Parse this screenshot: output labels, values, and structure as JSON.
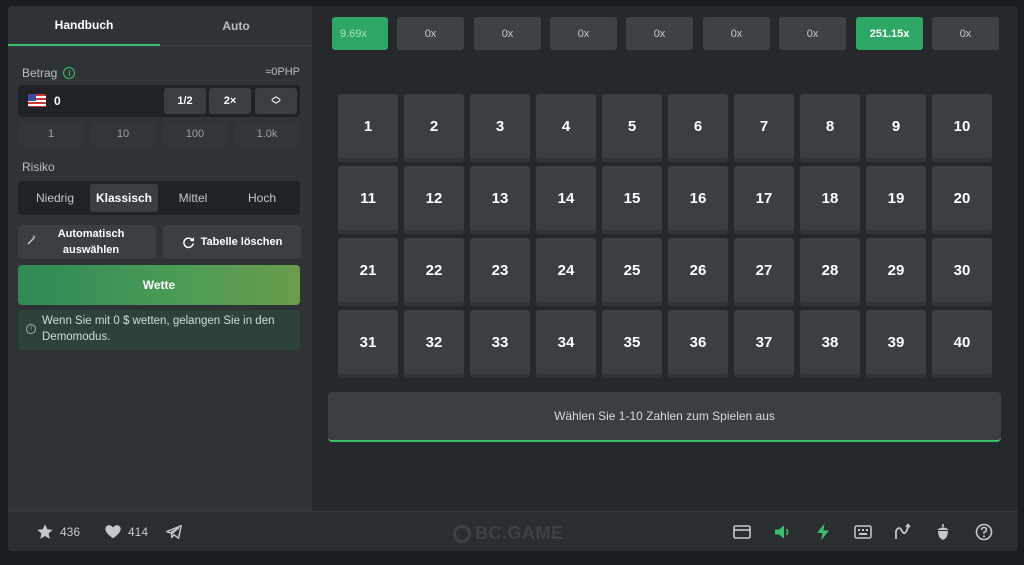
{
  "tabs": [
    {
      "label": "Handbuch",
      "active": true
    },
    {
      "label": "Auto",
      "active": false
    }
  ],
  "amount": {
    "label": "Betrag",
    "converted": "≈0PHP",
    "value": "0",
    "half_label": "1/2",
    "double_label": "2×",
    "chips": [
      "1",
      "10",
      "100",
      "1.0k"
    ]
  },
  "risk": {
    "label": "Risiko",
    "options": [
      "Niedrig",
      "Klassisch",
      "Mittel",
      "Hoch"
    ],
    "selected": "Klassisch"
  },
  "actions": {
    "auto_pick": "Automatisch auswählen",
    "clear_table": "Tabelle löschen"
  },
  "bet_button": "Wette",
  "notice": "Wenn Sie mit 0 $ wetten, gelangen Sie in den Demomodus.",
  "history": [
    {
      "value": "9.69x",
      "win": true
    },
    {
      "value": "0x",
      "win": false
    },
    {
      "value": "0x",
      "win": false
    },
    {
      "value": "0x",
      "win": false
    },
    {
      "value": "0x",
      "win": false
    },
    {
      "value": "0x",
      "win": false
    },
    {
      "value": "0x",
      "win": false
    },
    {
      "value": "251.15x",
      "win": true
    },
    {
      "value": "0x",
      "win": false
    }
  ],
  "grid_numbers": [
    "1",
    "2",
    "3",
    "4",
    "5",
    "6",
    "7",
    "8",
    "9",
    "10",
    "11",
    "12",
    "13",
    "14",
    "15",
    "16",
    "17",
    "18",
    "19",
    "20",
    "21",
    "22",
    "23",
    "24",
    "25",
    "26",
    "27",
    "28",
    "29",
    "30",
    "31",
    "32",
    "33",
    "34",
    "35",
    "36",
    "37",
    "38",
    "39",
    "40"
  ],
  "pick_prompt": "Wählen Sie 1-10 Zahlen zum Spielen aus",
  "footer": {
    "stars": "436",
    "likes": "414",
    "logo": "BC.GAME"
  },
  "colors": {
    "accent": "#3bbf6a",
    "win": "#2ea665",
    "panel": "#2e3335",
    "cell": "#3a3f42"
  }
}
